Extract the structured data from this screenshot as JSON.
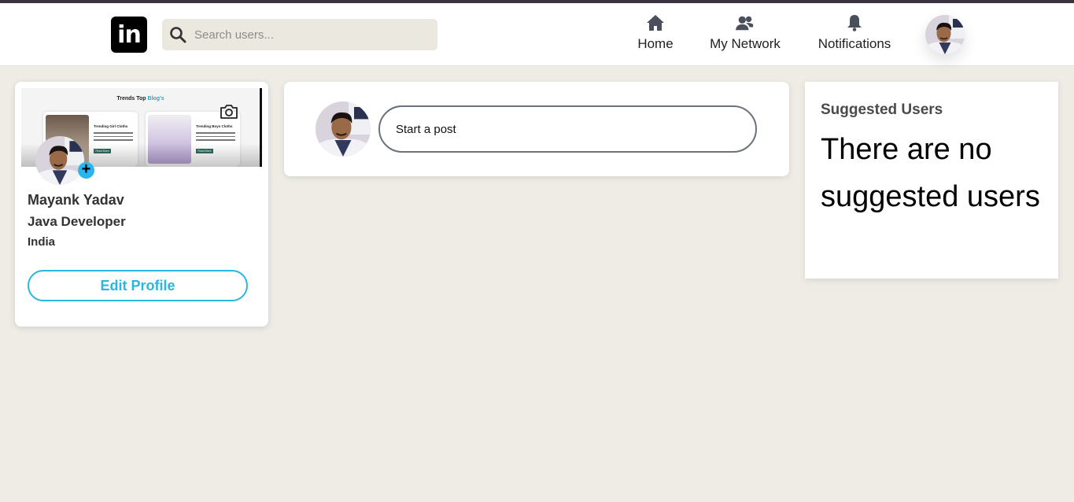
{
  "navbar": {
    "logo_text": "in",
    "search": {
      "placeholder": "Search users...",
      "value": ""
    },
    "items": [
      {
        "label": "Home",
        "icon": "home-icon"
      },
      {
        "label": "My Network",
        "icon": "network-icon"
      },
      {
        "label": "Notifications",
        "icon": "bell-icon"
      }
    ],
    "avatar_icon": "user-avatar"
  },
  "profile": {
    "cover": {
      "title_prefix": "Trends Top",
      "title_highlight": "Blog's",
      "tiles": [
        {
          "title": "Trending Girl Cloths",
          "button": "Read More"
        },
        {
          "title": "Trending Boys Cloths",
          "button": "Read More"
        }
      ],
      "camera_icon": "camera-icon"
    },
    "name": "Mayank Yadav",
    "headline": "Java Developer",
    "location": "India",
    "add_badge": "+",
    "edit_label": "Edit Profile"
  },
  "post": {
    "placeholder": "Start a post"
  },
  "suggested": {
    "title": "Suggested Users",
    "empty_message": "There are no suggested users"
  },
  "colors": {
    "background": "#eeece5",
    "accent": "#29b6e0",
    "top_strip": "#3a3340"
  }
}
